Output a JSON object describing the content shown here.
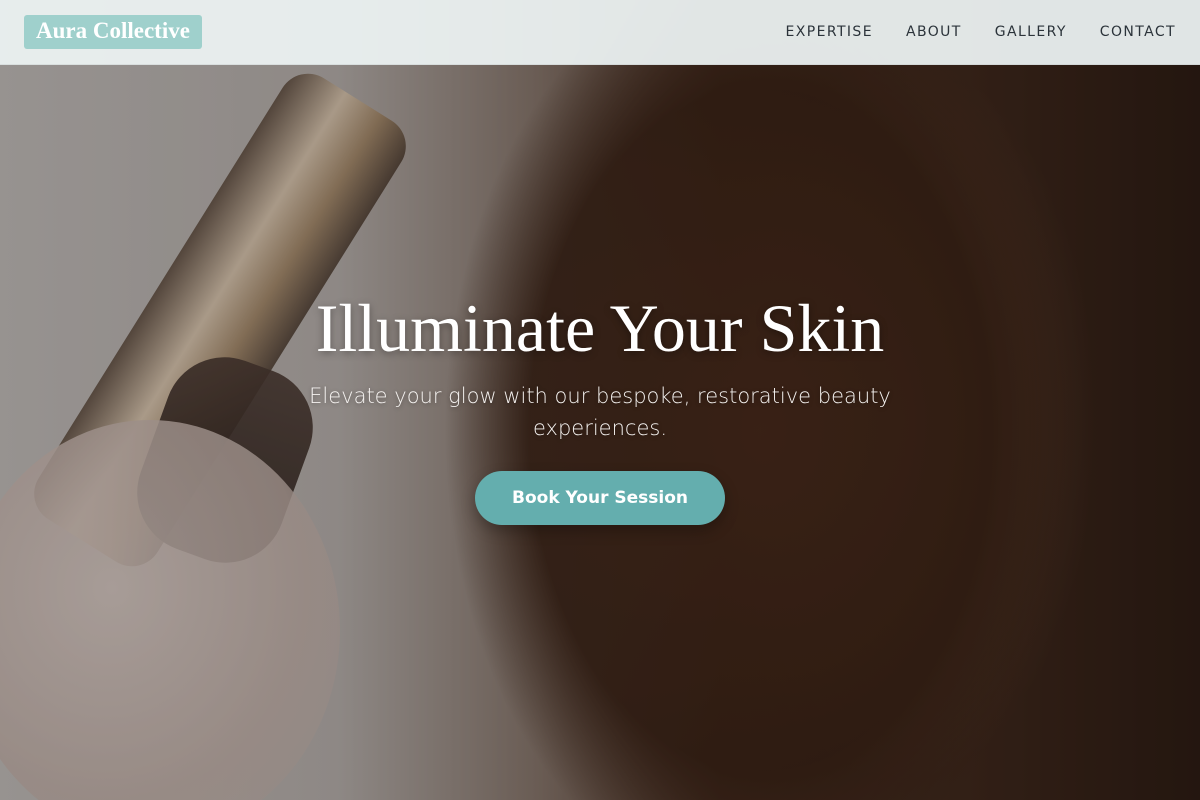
{
  "brand": {
    "name": "Aura Collective",
    "accent": "#9fd0cc"
  },
  "nav": {
    "items": [
      {
        "label": "EXPERTISE"
      },
      {
        "label": "ABOUT"
      },
      {
        "label": "GALLERY"
      },
      {
        "label": "CONTACT"
      }
    ]
  },
  "hero": {
    "title": "Illuminate Your Skin",
    "subtitle": "Elevate your glow with our bespoke, restorative beauty experiences.",
    "cta_label": "Book Your Session",
    "cta_color": "#64aeae",
    "image_icon": "hair-styling-photo"
  }
}
